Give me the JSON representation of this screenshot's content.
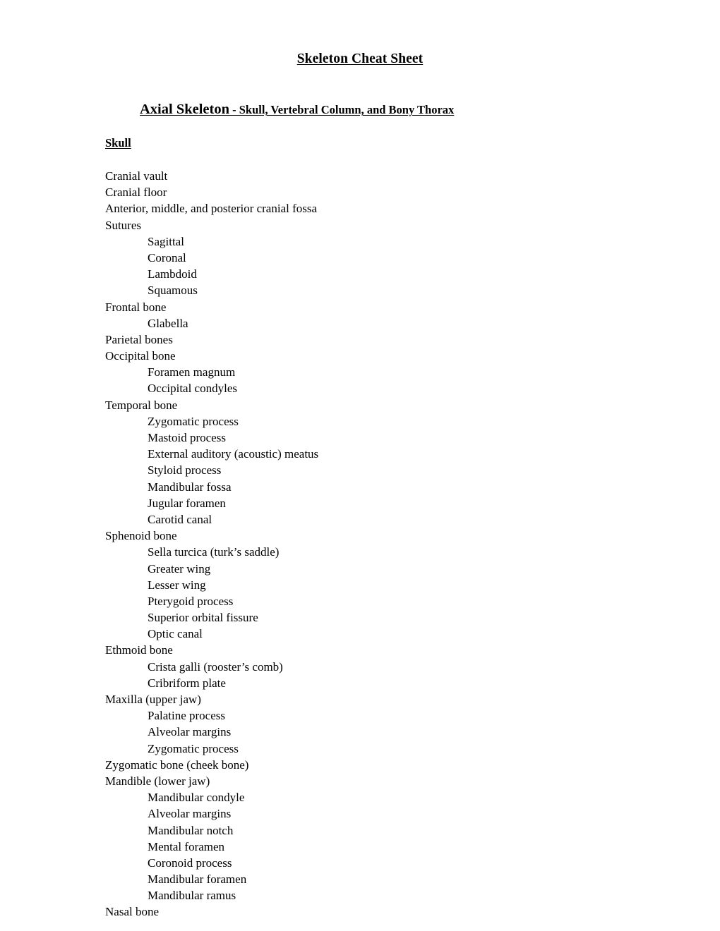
{
  "document": {
    "title": "Skeleton Cheat Sheet",
    "section_heading": {
      "emphasis": "Axial Skeleton",
      "remainder": " - Skull, Vertebral Column, and Bony Thorax"
    },
    "sub_heading": "Skull",
    "outline": [
      {
        "level": 0,
        "text": "Cranial vault"
      },
      {
        "level": 0,
        "text": "Cranial floor"
      },
      {
        "level": 0,
        "text": "Anterior, middle, and posterior cranial fossa"
      },
      {
        "level": 0,
        "text": "Sutures"
      },
      {
        "level": 1,
        "text": "Sagittal"
      },
      {
        "level": 1,
        "text": "Coronal"
      },
      {
        "level": 1,
        "text": "Lambdoid"
      },
      {
        "level": 1,
        "text": "Squamous"
      },
      {
        "level": 0,
        "text": "Frontal bone"
      },
      {
        "level": 1,
        "text": "Glabella"
      },
      {
        "level": 0,
        "text": "Parietal bones"
      },
      {
        "level": 0,
        "text": "Occipital bone"
      },
      {
        "level": 1,
        "text": "Foramen magnum"
      },
      {
        "level": 1,
        "text": "Occipital condyles"
      },
      {
        "level": 0,
        "text": "Temporal bone"
      },
      {
        "level": 1,
        "text": "Zygomatic process"
      },
      {
        "level": 1,
        "text": "Mastoid process"
      },
      {
        "level": 1,
        "text": "External auditory (acoustic) meatus"
      },
      {
        "level": 1,
        "text": "Styloid process"
      },
      {
        "level": 1,
        "text": "Mandibular fossa"
      },
      {
        "level": 1,
        "text": "Jugular foramen"
      },
      {
        "level": 1,
        "text": "Carotid canal"
      },
      {
        "level": 0,
        "text": "Sphenoid bone"
      },
      {
        "level": 1,
        "text": "Sella turcica (turk’s saddle)"
      },
      {
        "level": 1,
        "text": "Greater wing"
      },
      {
        "level": 1,
        "text": "Lesser wing"
      },
      {
        "level": 1,
        "text": "Pterygoid process"
      },
      {
        "level": 1,
        "text": "Superior orbital fissure"
      },
      {
        "level": 1,
        "text": "Optic canal"
      },
      {
        "level": 0,
        "text": "Ethmoid bone"
      },
      {
        "level": 1,
        "text": "Crista galli (rooster’s comb)"
      },
      {
        "level": 1,
        "text": "Cribriform plate"
      },
      {
        "level": 0,
        "text": "Maxilla (upper jaw)"
      },
      {
        "level": 1,
        "text": "Palatine process"
      },
      {
        "level": 1,
        "text": "Alveolar margins"
      },
      {
        "level": 1,
        "text": "Zygomatic process"
      },
      {
        "level": 0,
        "text": "Zygomatic bone (cheek bone)"
      },
      {
        "level": 0,
        "text": "Mandible (lower jaw)"
      },
      {
        "level": 1,
        "text": "Mandibular condyle"
      },
      {
        "level": 1,
        "text": "Alveolar margins"
      },
      {
        "level": 1,
        "text": "Mandibular notch"
      },
      {
        "level": 1,
        "text": "Mental foramen"
      },
      {
        "level": 1,
        "text": "Coronoid process"
      },
      {
        "level": 1,
        "text": "Mandibular foramen"
      },
      {
        "level": 1,
        "text": "Mandibular ramus"
      },
      {
        "level": 0,
        "text": "Nasal bone"
      }
    ]
  }
}
